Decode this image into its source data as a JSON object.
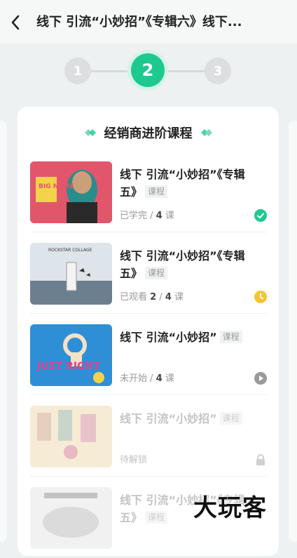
{
  "header": {
    "title": "线下 引流“小妙招”《专辑六》线下..."
  },
  "stepper": {
    "steps": [
      "1",
      "2",
      "3"
    ],
    "active_index": 1
  },
  "card": {
    "title": "经销商进阶课程"
  },
  "courses": [
    {
      "title": "线下 引流“小妙招”《专辑五》",
      "tag": "课程",
      "meta_prefix": "已学完",
      "meta_sep": " / ",
      "meta_total": "4",
      "meta_unit": " 课",
      "status": "completed",
      "status_icon": "check-circle-icon",
      "thumb_caption": "BIG NAME"
    },
    {
      "title": "线下 引流“小妙招”《专辑五》",
      "tag": "课程",
      "meta_prefix": "已观看 ",
      "meta_watched": "2",
      "meta_sep": " / ",
      "meta_total": "4",
      "meta_unit": " 课",
      "status": "in-progress",
      "status_icon": "clock-icon",
      "thumb_caption": "ROCKSTAR COLLAGE"
    },
    {
      "title": "线下 引流“小妙招”",
      "tag": "课程",
      "meta_prefix": "未开始",
      "meta_sep": " / ",
      "meta_total": "4",
      "meta_unit": " 课",
      "status": "not-started",
      "status_icon": "play-circle-icon",
      "thumb_caption": "JUST RIGHT"
    },
    {
      "title": "线下 引流“小妙招”",
      "tag": "课程",
      "meta_prefix": "待解锁",
      "status": "locked",
      "status_icon": "lock-icon"
    },
    {
      "title": "线下 引流“小妙招”《专辑五》",
      "tag": "课程",
      "status": "locked"
    }
  ],
  "watermark": "大玩客",
  "colors": {
    "accent": "#1dc98e",
    "in_progress": "#f3c534",
    "muted": "#9a9a9a"
  }
}
